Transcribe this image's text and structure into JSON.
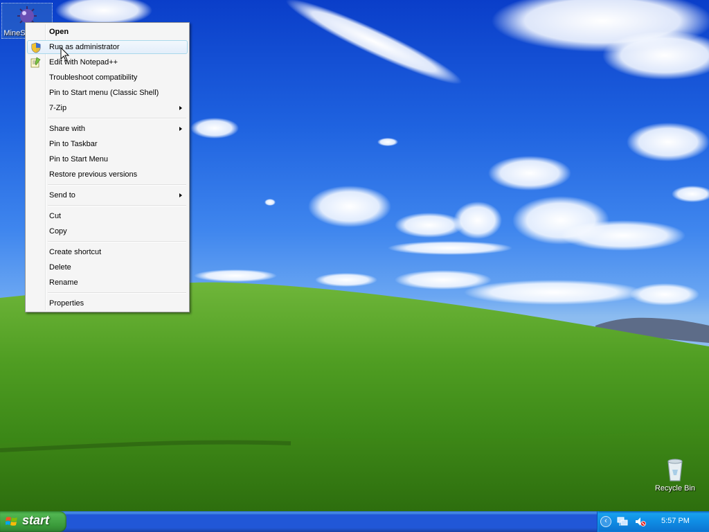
{
  "desktop": {
    "icons": [
      {
        "label": "MineSweeper",
        "icon": "minesweeper-mine-icon"
      },
      {
        "label": "Recycle Bin",
        "icon": "recycle-bin-icon"
      }
    ]
  },
  "context_menu": {
    "items": [
      {
        "label": "Open",
        "bold": true
      },
      {
        "label": "Run as administrator",
        "icon": "uac-shield-icon",
        "highlighted": true
      },
      {
        "label": "Edit with Notepad++",
        "icon": "notepad-plus-plus-icon"
      },
      {
        "label": "Troubleshoot compatibility"
      },
      {
        "label": "Pin to Start menu (Classic Shell)"
      },
      {
        "label": "7-Zip",
        "submenu": true
      },
      {
        "label": "Share with",
        "submenu": true
      },
      {
        "label": "Pin to Taskbar"
      },
      {
        "label": "Pin to Start Menu"
      },
      {
        "label": "Restore previous versions"
      },
      {
        "label": "Send to",
        "submenu": true
      },
      {
        "label": "Cut"
      },
      {
        "label": "Copy"
      },
      {
        "label": "Create shortcut"
      },
      {
        "label": "Delete"
      },
      {
        "label": "Rename"
      },
      {
        "label": "Properties"
      }
    ]
  },
  "taskbar": {
    "start_label": "start",
    "clock": "5:57 PM",
    "tray_icons": [
      "show-hidden-icons-chevron-icon",
      "network-icon",
      "volume-muted-icon"
    ]
  },
  "colors": {
    "taskbar_blue": "#2157d7",
    "start_green": "#3a9a3a",
    "menu_highlight_border": "#a8d8eb"
  }
}
